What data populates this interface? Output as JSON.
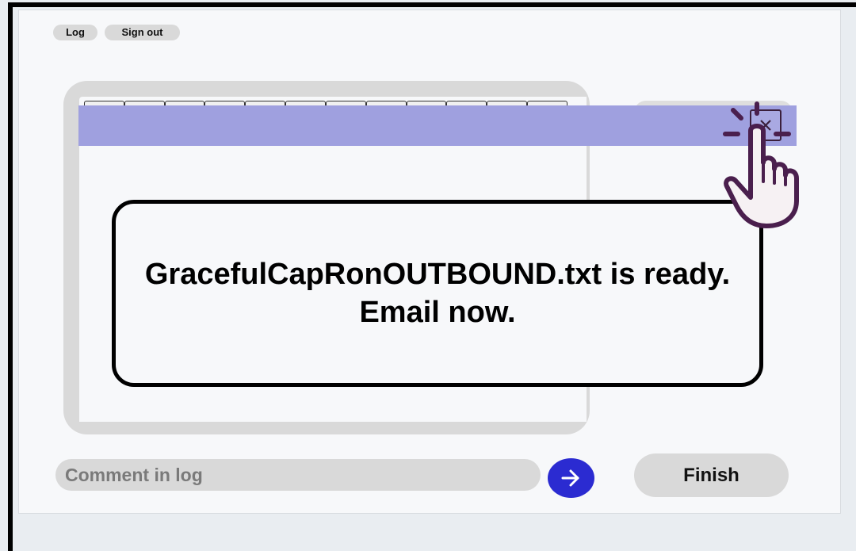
{
  "header": {
    "log_label": "Log",
    "signout_label": "Sign out"
  },
  "dialog": {
    "message": "GracefulCapRonOUTBOUND.txt is ready. Email now."
  },
  "footer": {
    "comment_placeholder": "Comment in log",
    "finish_label": "Finish"
  },
  "icons": {
    "close": "close-icon",
    "send": "arrow-right-icon",
    "cursor": "hand-pointer-icon"
  },
  "colors": {
    "titlebar": "#9fa0df",
    "send_button": "#2b2bd1",
    "hand_outline": "#4a1f4d"
  }
}
